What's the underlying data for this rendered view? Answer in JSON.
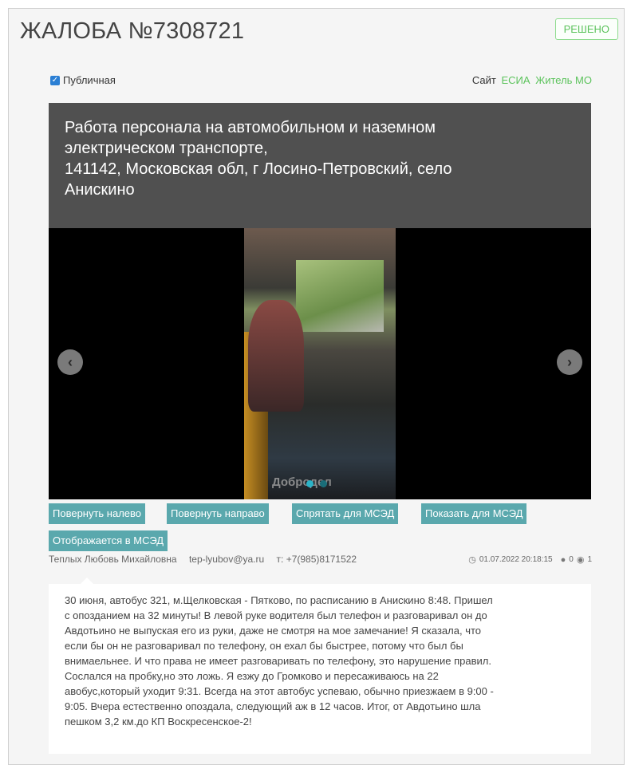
{
  "header": {
    "title": "ЖАЛОБА №7308721",
    "status": "РЕШЕНО"
  },
  "public": {
    "label": "Публичная",
    "checked": true
  },
  "source": {
    "label": "Сайт",
    "links": [
      "ЕСИА",
      "Житель МО"
    ]
  },
  "category": {
    "lines": [
      "Работа персонала на автомобильном и наземном",
      "электрическом транспорте,",
      "141142, Московская обл, г Лосино-Петровский, село",
      "Анискино"
    ]
  },
  "gallery": {
    "watermark": "Добродел",
    "slides": 2,
    "active_slide": 1
  },
  "buttons": {
    "rotate_left": "Повернуть налево",
    "rotate_right": "Повернуть направо",
    "hide_msed": "Спрятать для МСЭД",
    "show_msed": "Показать для МСЭД",
    "shown_msed": "Отображается в МСЭД"
  },
  "author": {
    "name": "Теплых Любовь Михайловна",
    "email": "tep-lyubov@ya.ru",
    "phone": "т: +7(985)8171522",
    "datetime": "01.07.2022 20:18:15",
    "comments": "0",
    "views": "1"
  },
  "message": {
    "lines": [
      "30 июня, автобус 321, м.Щелковская - Пятково, по расписанию в Анискино 8:48. Пришел",
      "с опозданием на 32 минуты! В левой руке водителя был телефон и разговаривал он до",
      "Авдотьино не выпуская его из руки, даже не смотря на мое замечание! Я сказала, что",
      "если бы он не разговаривал по телефону, он ехал бы быстрее, потому что был бы",
      "внимаельнее. И что права не имеет разговаривать по телефону, это нарушение правил.",
      "Сослался на пробку,но это ложь. Я езжу до Громково и пересаживаюсь на 22",
      "авобус,который уходит 9:31. Всегда на этот автобус успеваю, обычно приезжаем в 9:00 -",
      "9:05. Вчера естественно опоздала, следующий аж в 12 часов. Итог, от Авдотьино шла",
      "пешком 3,2 км.до КП Воскресенское-2!"
    ]
  },
  "colors": {
    "accent_green": "#5cc35c",
    "button_teal": "#5aa8ad",
    "header_dark": "#505050"
  }
}
